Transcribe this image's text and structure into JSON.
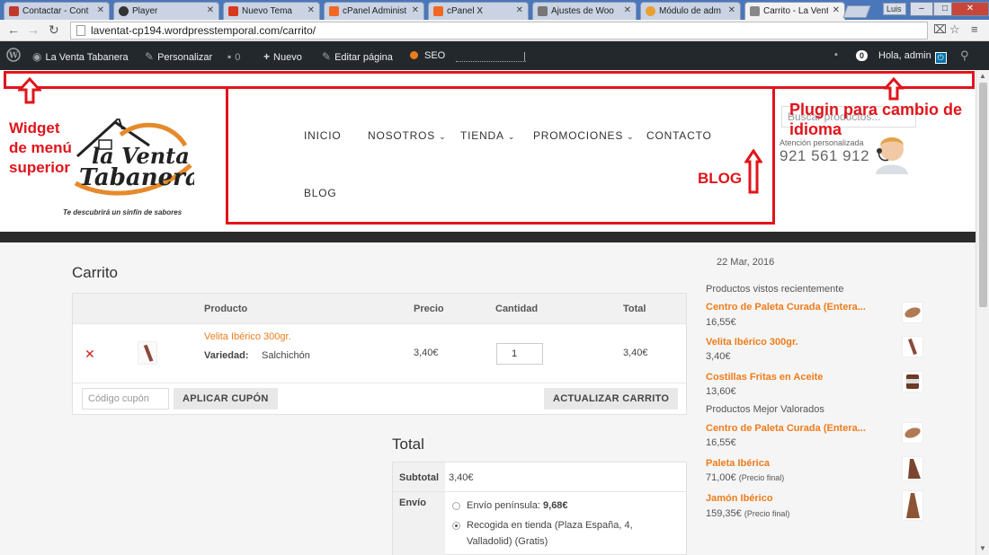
{
  "browser": {
    "tabs": [
      {
        "label": "Contactar - Cont",
        "favicon_color": "#c0392b"
      },
      {
        "label": "Player",
        "favicon_color": "#333333"
      },
      {
        "label": "Nuevo Tema",
        "favicon_color": "#d9381e"
      },
      {
        "label": "cPanel Administ",
        "favicon_color": "#f26822"
      },
      {
        "label": "cPanel X",
        "favicon_color": "#f26822"
      },
      {
        "label": "Ajustes de Woo",
        "favicon_color": "#777777"
      },
      {
        "label": "Módulo de adm",
        "favicon_color": "#e9a030"
      },
      {
        "label": "Carrito - La Vent",
        "favicon_color": "#888888"
      }
    ],
    "user_label": "Luis",
    "url": "laventat-cp194.wordpresstemporal.com/carrito/"
  },
  "adminbar": {
    "site_name": "La Venta Tabanera",
    "customize": "Personalizar",
    "comments_count": "0",
    "new": "Nuevo",
    "edit_page": "Editar página",
    "seo": "SEO",
    "notifications_count": "0",
    "greeting": "Hola, admin"
  },
  "annotations": {
    "widget_label": "Widget\nde menú\nsuperior",
    "plugin_label": "Plugin para cambio de\nidioma",
    "blog_label": "BLOG",
    "color": "#e1141b"
  },
  "header": {
    "logo_line1": "la Venta",
    "logo_line2": "Tabanera",
    "tagline": "Te descubrirá un sinfín de sabores",
    "menu": [
      "INICIO",
      "NOSOTROS",
      "TIENDA",
      "PROMOCIONES",
      "CONTACTO",
      "BLOG"
    ],
    "search_placeholder": "Buscar productos...",
    "support_label": "Atención personalizada",
    "phone": "921 561 912"
  },
  "cart": {
    "title": "Carrito",
    "columns": [
      "Producto",
      "Precio",
      "Cantidad",
      "Total"
    ],
    "item": {
      "name": "Velita Ibérico 300gr.",
      "variation_label": "Variedad:",
      "variation_value": "Salchichón",
      "price": "3,40€",
      "quantity": "1",
      "total": "3,40€"
    },
    "coupon_placeholder": "Código cupón",
    "apply_coupon": "APLICAR CUPÓN",
    "update_cart": "ACTUALIZAR CARRITO"
  },
  "totals": {
    "title": "Total",
    "subtotal_label": "Subtotal",
    "subtotal_value": "3,40€",
    "shipping_label": "Envío",
    "option1_label": "Envío península:",
    "option1_price": "9,68€",
    "option2_line1": "Recogida en tienda (Plaza España, 4,",
    "option2_line2": "Valladolid) (Gratis)"
  },
  "sidebar": {
    "date": "22 Mar, 2016",
    "recent_title": "Productos vistos recientemente",
    "recent": [
      {
        "name": "Centro de Paleta Curada (Entera...",
        "price": "16,55€",
        "note": ""
      },
      {
        "name": "Velita Ibérico 300gr.",
        "price": "3,40€",
        "note": ""
      },
      {
        "name": "Costillas Fritas en Aceite",
        "price": "13,60€",
        "note": ""
      }
    ],
    "top_title": "Productos Mejor Valorados",
    "top": [
      {
        "name": "Centro de Paleta Curada (Entera...",
        "price": "16,55€",
        "note": ""
      },
      {
        "name": "Paleta Ibérica",
        "price": "71,00€",
        "note": "(Precio final)"
      },
      {
        "name": "Jamón Ibérico",
        "price": "159,35€",
        "note": "(Precio final)"
      }
    ]
  }
}
